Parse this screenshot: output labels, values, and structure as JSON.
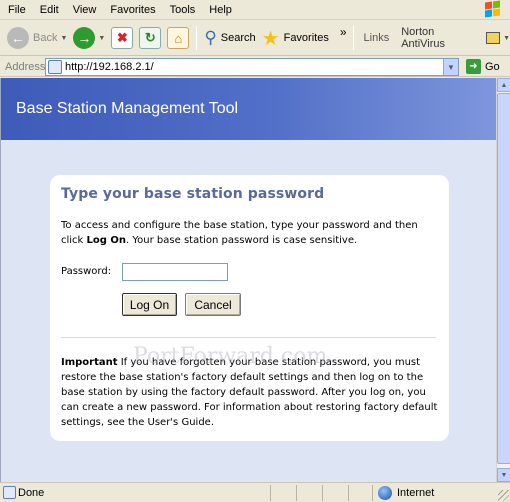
{
  "menu": {
    "items": [
      "File",
      "Edit",
      "View",
      "Favorites",
      "Tools",
      "Help"
    ]
  },
  "toolbar": {
    "back_label": "Back",
    "search_label": "Search",
    "favorites_label": "Favorites",
    "chevron": "»",
    "links_label": "Links",
    "norton_label": "Norton AntiVirus"
  },
  "address": {
    "label": "Address",
    "url": "http://192.168.2.1/",
    "go_label": "Go"
  },
  "page": {
    "banner_title": "Base Station Management Tool",
    "card_title": "Type your base station password",
    "intro_before": "To access and configure the base station, type your password and then click ",
    "intro_bold": "Log On",
    "intro_after": ". Your base station password is case sensitive.",
    "password_label": "Password:",
    "password_value": "",
    "logon_button": "Log On",
    "cancel_button": "Cancel",
    "important_bold": "Important",
    "important_text": "  If you have forgotten your base station password, you must restore the base station's factory default settings and then log on to the base station by using the factory default password. After you log on, you can create a new password. For information about restoring factory default settings, see the User's Guide.",
    "watermark": "PortForward.com"
  },
  "status": {
    "left": "Done",
    "zone": "Internet"
  },
  "colors": {
    "banner_start": "#3d5bb8",
    "banner_end": "#7e96dc",
    "page_background": "#dde4f4",
    "card_title": "#576a99"
  }
}
